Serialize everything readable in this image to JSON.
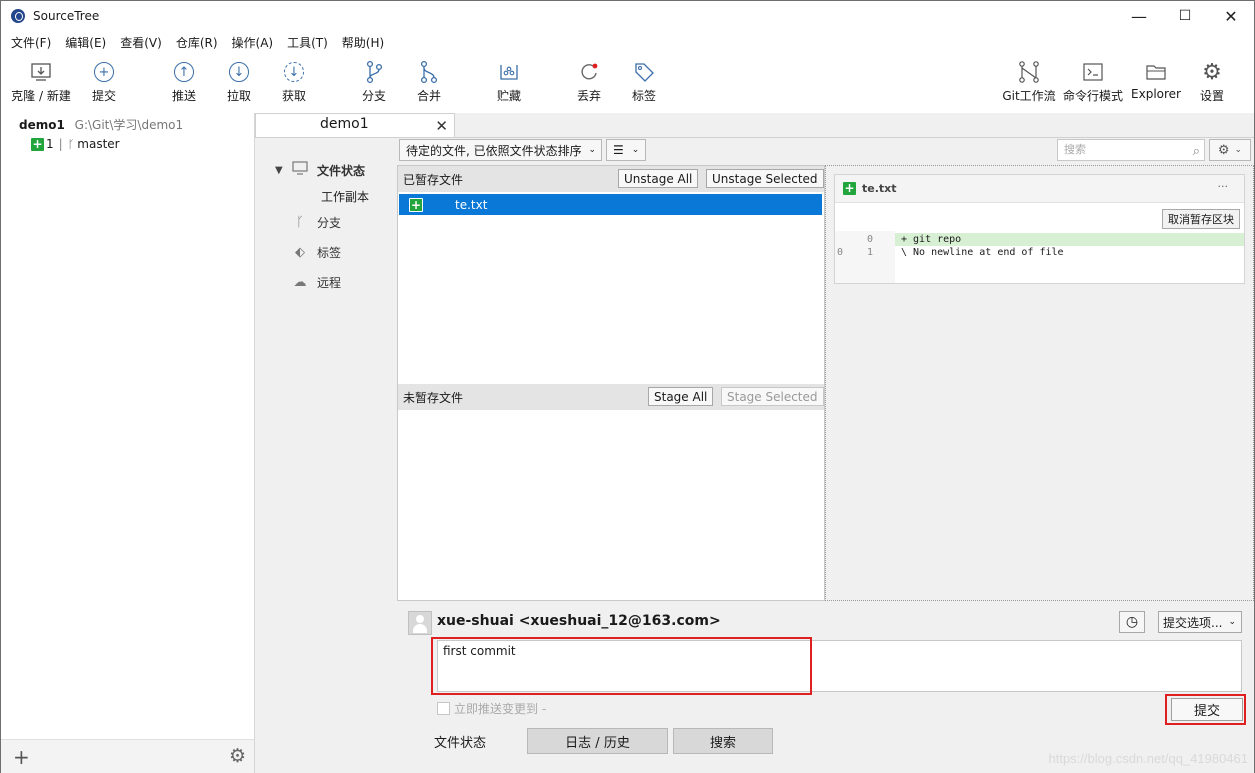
{
  "window": {
    "title": "SourceTree",
    "minimize": "—",
    "maximize": "☐",
    "close": "✕"
  },
  "menu": [
    "文件(F)",
    "编辑(E)",
    "查看(V)",
    "仓库(R)",
    "操作(A)",
    "工具(T)",
    "帮助(H)"
  ],
  "toolbar": {
    "clone": "克隆 / 新建",
    "commit": "提交",
    "push": "推送",
    "pull": "拉取",
    "fetch": "获取",
    "branch": "分支",
    "merge": "合并",
    "stash": "贮藏",
    "discard": "丢弃",
    "tag": "标签",
    "gitflow": "Git工作流",
    "terminal": "命令行模式",
    "explorer": "Explorer",
    "settings": "设置"
  },
  "repo": {
    "name": "demo1",
    "path": "G:\\Git\\学习\\demo1",
    "ahead_count": "1",
    "separator": "|",
    "branch": "master"
  },
  "tab": {
    "label": "demo1",
    "close": "✕"
  },
  "nav": {
    "file_status": "文件状态",
    "working_copy": "工作副本",
    "branches": "分支",
    "tags": "标签",
    "remotes": "远程"
  },
  "filter": {
    "sort_label": "待定的文件, 已依照文件状态排序",
    "search_placeholder": "搜索"
  },
  "staged": {
    "header": "已暂存文件",
    "unstage_all": "Unstage All",
    "unstage_selected": "Unstage Selected",
    "files": [
      {
        "name": "te.txt",
        "status": "added"
      }
    ]
  },
  "unstaged": {
    "header": "未暂存文件",
    "stage_all": "Stage All",
    "stage_selected": "Stage Selected"
  },
  "diff": {
    "file": "te.txt",
    "more": "···",
    "discard_hunk": "取消暂存区块",
    "lines": [
      {
        "old": "",
        "new": "0",
        "text": "+ git repo"
      },
      {
        "old": "0",
        "new": "1",
        "text": "\\  No newline at end of file"
      }
    ]
  },
  "commit": {
    "author": "xue-shuai <xueshuai_12@163.com>",
    "message": "first commit",
    "options": "提交选项...",
    "push_immediately": "立即推送变更到 -",
    "submit": "提交"
  },
  "bottom_tabs": [
    "文件状态",
    "日志 / 历史",
    "搜索"
  ],
  "watermark": "https://blog.csdn.net/qq_41980461",
  "colors": {
    "accent": "#0a78d7",
    "added": "#22a53c",
    "highlight_box": "#e02020",
    "diff_added_bg": "#d7efd2"
  }
}
